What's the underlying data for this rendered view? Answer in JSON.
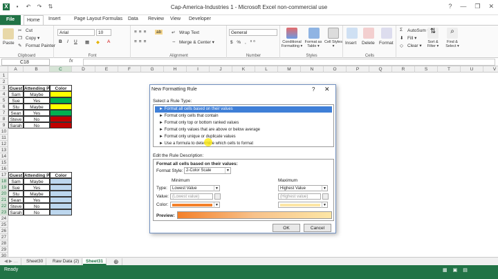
{
  "window": {
    "title": "Cap-America-Industries 1 - Microsoft Excel non-commercial use"
  },
  "tabs": [
    "FILE",
    "HOME",
    "INSERT",
    "PAGE LAYOUT",
    "FORMULAS",
    "DATA",
    "REVIEW",
    "VIEW",
    "DEVELOPER"
  ],
  "tab_labels": {
    "file": "File",
    "home": "Home",
    "insert": "Insert",
    "page_layout": "Page Layout",
    "formulas": "Formulas",
    "data": "Data",
    "review": "Review",
    "view": "View",
    "developer": "Developer"
  },
  "ribbon": {
    "clipboard": {
      "paste": "Paste",
      "cut": "Cut",
      "copy": "Copy ▾",
      "format_painter": "Format Painter",
      "label": "Clipboard"
    },
    "font": {
      "name": "Arial",
      "size": "10",
      "label": "Font"
    },
    "alignment": {
      "wrap": "Wrap Text",
      "merge": "Merge & Center ▾",
      "label": "Alignment"
    },
    "number": {
      "format": "General",
      "label": "Number"
    },
    "styles": {
      "conditional": "Conditional Formatting ▾",
      "format_table": "Format as Table ▾",
      "cell_styles": "Cell Styles ▾",
      "label": "Styles"
    },
    "cells": {
      "insert": "Insert",
      "delete": "Delete",
      "format": "Format",
      "label": "Cells"
    },
    "editing": {
      "autosum": "AutoSum ▾",
      "fill": "Fill ▾",
      "clear": "Clear ▾",
      "sort": "Sort & Filter ▾",
      "find": "Find & Select ▾"
    }
  },
  "formula_bar": {
    "name_box": "C18",
    "fx": "fx",
    "value": ""
  },
  "columns": [
    "A",
    "B",
    "C",
    "D",
    "E",
    "F",
    "G",
    "H",
    "I",
    "J",
    "K",
    "L",
    "M",
    "N",
    "O",
    "P",
    "Q",
    "R",
    "S",
    "T",
    "U",
    "V"
  ],
  "rows": [
    "1",
    "2",
    "3",
    "4",
    "5",
    "6",
    "7",
    "8",
    "9",
    "10",
    "11",
    "12",
    "13",
    "14",
    "15",
    "16",
    "17",
    "18",
    "19",
    "20",
    "21",
    "22",
    "23",
    "24",
    "25",
    "26",
    "27",
    "28",
    "29",
    "30",
    "31"
  ],
  "table1": {
    "headers": [
      "Guest",
      "Attending Party",
      "Color"
    ],
    "rows": [
      {
        "guest": "Sam",
        "party": "Maybe",
        "color": "#ffff00"
      },
      {
        "guest": "Sue",
        "party": "Yes",
        "color": "#00b050"
      },
      {
        "guest": "Stu",
        "party": "Maybe",
        "color": "#ffff00"
      },
      {
        "guest": "Sean",
        "party": "Yes",
        "color": "#00b050"
      },
      {
        "guest": "Steve",
        "party": "No",
        "color": "#c00000"
      },
      {
        "guest": "Sarah",
        "party": "No",
        "color": "#c00000"
      }
    ]
  },
  "table2": {
    "headers": [
      "Guest",
      "Attending Party",
      "Color"
    ],
    "rows": [
      {
        "guest": "Sam",
        "party": "Maybe"
      },
      {
        "guest": "Sue",
        "party": "Yes"
      },
      {
        "guest": "Stu",
        "party": "Maybe"
      },
      {
        "guest": "Sean",
        "party": "Yes"
      },
      {
        "guest": "Steve",
        "party": "No"
      },
      {
        "guest": "Sarah",
        "party": "No"
      }
    ],
    "selection_color": "#bdd7ee"
  },
  "sheets": [
    "Sheet30",
    "Raw Data (2)",
    "Sheet31"
  ],
  "active_sheet": "Sheet31",
  "status": {
    "ready": "Ready"
  },
  "dialog": {
    "title": "New Formatting Rule",
    "help": "?",
    "close": "✕",
    "select_rule_label": "Select a Rule Type:",
    "rule_types": [
      "► Format all cells based on their values",
      "► Format only cells that contain",
      "► Format only top or bottom ranked values",
      "► Format only values that are above or below average",
      "► Format only unique or duplicate values",
      "► Use a formula to determine which cells to format"
    ],
    "edit_label": "Edit the Rule Description:",
    "desc_header": "Format all cells based on their values:",
    "format_style_label": "Format Style:",
    "format_style": "2-Color Scale",
    "minimum_label": "Minimum",
    "maximum_label": "Maximum",
    "type_label": "Type:",
    "value_label": "Value:",
    "color_label": "Color:",
    "min_type": "Lowest Value",
    "max_type": "Highest Value",
    "min_value": "(Lowest value)",
    "max_value": "(Highest value)",
    "min_color": "#f4802a",
    "max_color": "#fde6a5",
    "preview_label": "Preview:",
    "ok": "OK",
    "cancel": "Cancel"
  }
}
